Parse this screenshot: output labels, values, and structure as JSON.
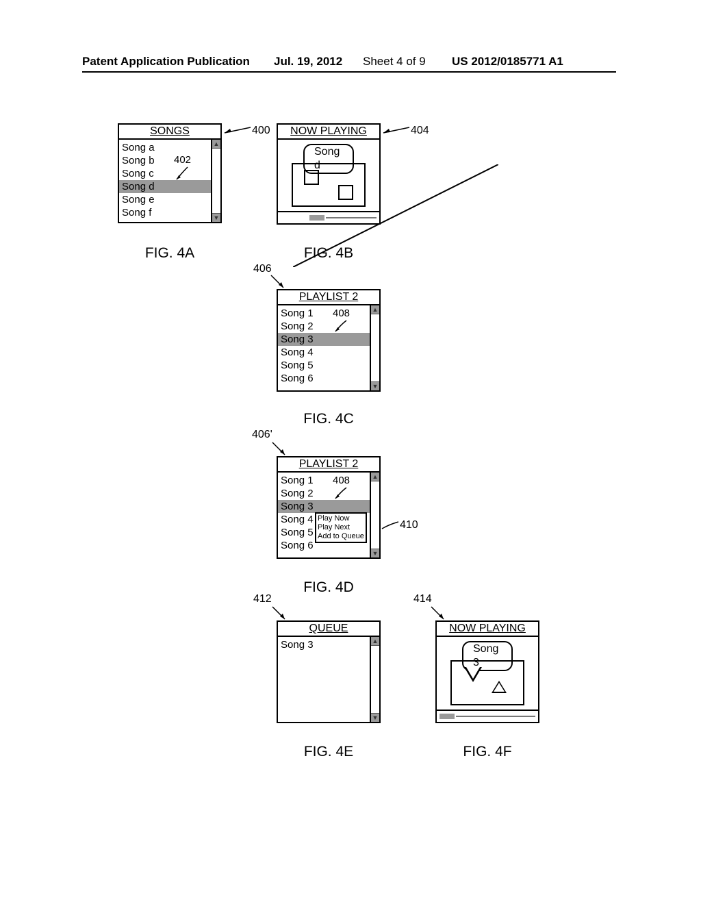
{
  "header": {
    "pub": "Patent Application Publication",
    "date": "Jul. 19, 2012",
    "sheet": "Sheet 4 of 9",
    "pubno": "US 2012/0185771 A1"
  },
  "fig4a": {
    "label": "FIG. 4A",
    "title": "SONGS",
    "items": [
      "Song a",
      "Song b",
      "Song c",
      "Song d",
      "Song e",
      "Song f"
    ],
    "selected": "Song d",
    "callout_panel": "400",
    "callout_selection": "402"
  },
  "fig4b": {
    "label": "FIG. 4B",
    "title": "NOW PLAYING",
    "current": "Song d",
    "callout_panel": "404"
  },
  "fig4c": {
    "label": "FIG. 4C",
    "title": "PLAYLIST 2",
    "items": [
      "Song 1",
      "Song 2",
      "Song 3",
      "Song 4",
      "Song 5",
      "Song 6"
    ],
    "selected": "Song 3",
    "callout_panel": "406",
    "callout_selection": "408"
  },
  "fig4d": {
    "label": "FIG. 4D",
    "title": "PLAYLIST 2",
    "items": [
      "Song 1",
      "Song 2",
      "Song 3",
      "Song 4",
      "Song 5",
      "Song 6"
    ],
    "selected": "Song 3",
    "menu": [
      "Play Now",
      "Play Next",
      "Add to Queue"
    ],
    "callout_panel": "406'",
    "callout_selection": "408",
    "callout_menu": "410"
  },
  "fig4e": {
    "label": "FIG. 4E",
    "title": "QUEUE",
    "items": [
      "Song 3"
    ],
    "callout_panel": "412"
  },
  "fig4f": {
    "label": "FIG. 4F",
    "title": "NOW PLAYING",
    "current": "Song 3",
    "callout_panel": "414"
  }
}
